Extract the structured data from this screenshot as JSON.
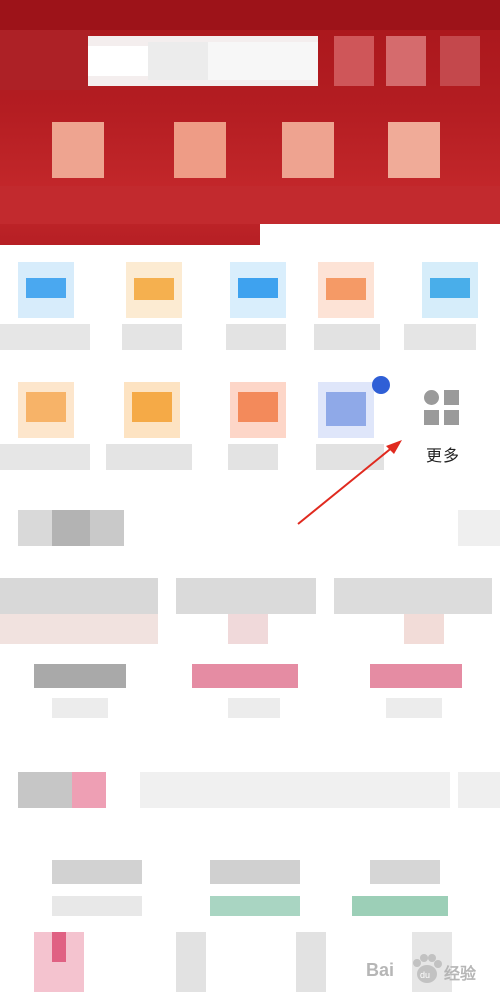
{
  "more_button": {
    "label": "更多"
  },
  "watermark": {
    "brand_left": "Bai",
    "brand_right": "经验",
    "logo_text": "du"
  },
  "icon_grid": {
    "rows": [
      [
        {
          "color": "#4aa8f0"
        },
        {
          "color": "#f5b04f"
        },
        {
          "color": "#3ea2ef"
        },
        {
          "color": "#f59a66"
        },
        {
          "color": "#49aeea"
        }
      ],
      [
        {
          "color": "#f7b368"
        },
        {
          "color": "#f5aa47"
        },
        {
          "color": "#f38a5b"
        },
        {
          "color": "#8fa9e8"
        }
      ]
    ]
  },
  "annotation": {
    "arrow_color": "#e02a1f",
    "badge_color": "#2f5fd6"
  },
  "colors": {
    "header_red": "#b41d22",
    "pink_bar": "#e58ca3",
    "green_bar": "#a9d5c2"
  }
}
